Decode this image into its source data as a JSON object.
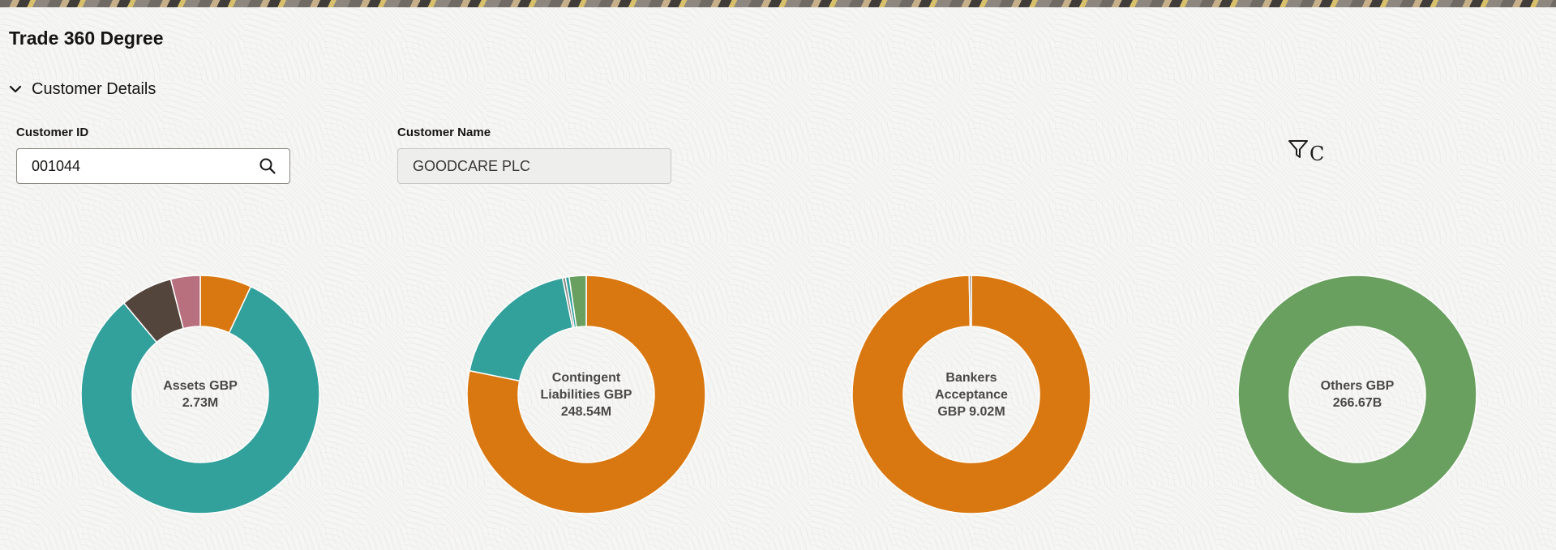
{
  "page": {
    "title": "Trade 360 Degree"
  },
  "customer_section": {
    "title": "Customer Details",
    "customer_id": {
      "label": "Customer ID",
      "value": "001044"
    },
    "customer_name": {
      "label": "Customer Name",
      "value": "GOODCARE PLC"
    },
    "filter_label": "C"
  },
  "colors": {
    "orange": "#d97811",
    "teal": "#32a09b",
    "dark_brown": "#54453c",
    "mauve": "#b8707f",
    "green": "#6aa05f",
    "gray": "#8a8680",
    "label_text": "#4a4845"
  },
  "icons": [
    "chevron-down-icon",
    "search-icon",
    "filter-icon"
  ],
  "chart_data": [
    {
      "type": "pie",
      "label_lines": [
        "Assets GBP",
        "2.73M"
      ],
      "slices": [
        {
          "value": 6.8,
          "color": "#d97811"
        },
        {
          "value": 80.0,
          "color": "#32a09b"
        },
        {
          "value": 6.9,
          "color": "#54453c"
        },
        {
          "value": 3.9,
          "color": "#b8707f"
        }
      ]
    },
    {
      "type": "pie",
      "label_lines": [
        "Contingent",
        "Liabilities GBP",
        "248.54M"
      ],
      "slices": [
        {
          "value": 78.2,
          "color": "#d97811"
        },
        {
          "value": 18.6,
          "color": "#32a09b"
        },
        {
          "value": 0.4,
          "color": "#8a8680"
        },
        {
          "value": 0.5,
          "color": "#32a09b"
        },
        {
          "value": 2.3,
          "color": "#6aa05f"
        }
      ]
    },
    {
      "type": "pie",
      "label_lines": [
        "Bankers",
        "Acceptance",
        "GBP 9.02M"
      ],
      "slices": [
        {
          "value": 99.7,
          "color": "#d97811"
        },
        {
          "value": 0.3,
          "color": "#8a8680"
        }
      ]
    },
    {
      "type": "pie",
      "label_lines": [
        "Others GBP",
        "266.67B"
      ],
      "slices": [
        {
          "value": 100,
          "color": "#6aa05f"
        }
      ]
    }
  ]
}
